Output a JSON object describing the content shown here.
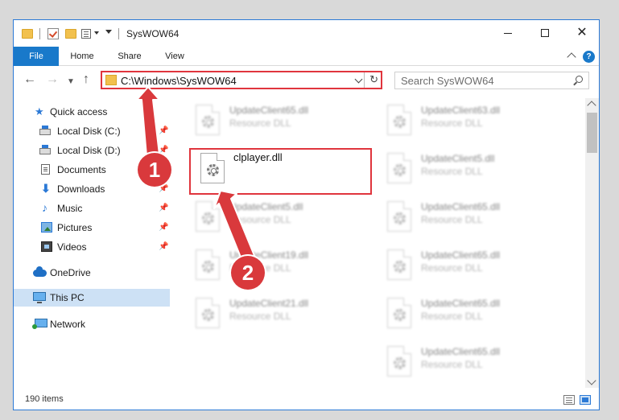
{
  "window": {
    "title": "SysWOW64",
    "accent_color": "#1979ca",
    "highlight_color": "#e0353d"
  },
  "ribbon": {
    "tabs": [
      "File",
      "Home",
      "Share",
      "View"
    ],
    "help_label": "?"
  },
  "address_bar": {
    "path": "C:\\Windows\\SysWOW64",
    "refresh_icon": "refresh-icon"
  },
  "search": {
    "placeholder": "Search SysWOW64"
  },
  "navigation": {
    "quick_access": {
      "label": "Quick access",
      "items": [
        {
          "label": "Local Disk (C:)",
          "icon": "drive-icon",
          "pinned": true
        },
        {
          "label": "Local Disk (D:)",
          "icon": "drive-icon",
          "pinned": true
        },
        {
          "label": "Documents",
          "icon": "documents-icon",
          "pinned": true
        },
        {
          "label": "Downloads",
          "icon": "downloads-icon",
          "pinned": true
        },
        {
          "label": "Music",
          "icon": "music-icon",
          "pinned": true
        },
        {
          "label": "Pictures",
          "icon": "pictures-icon",
          "pinned": true
        },
        {
          "label": "Videos",
          "icon": "videos-icon",
          "pinned": true
        }
      ]
    },
    "onedrive": "OneDrive",
    "this_pc": "This PC",
    "network": "Network",
    "pin_glyph": "📌"
  },
  "files": {
    "highlighted": {
      "name": "clplayer.dll"
    },
    "col1": [
      {
        "name": "UpdateClient65.dll",
        "type": "Resource DLL"
      },
      {
        "name": "UpdateClient5.dll",
        "type": "Resource DLL"
      },
      {
        "name": "UpdateClient19.dll",
        "type": "Resource DLL"
      },
      {
        "name": "UpdateClient21.dll",
        "type": "Resource DLL"
      }
    ],
    "col2": [
      {
        "name": "UpdateClient63.dll",
        "type": "Resource DLL"
      },
      {
        "name": "UpdateClient5.dll",
        "type": "Resource DLL"
      },
      {
        "name": "UpdateClient65.dll",
        "type": "Resource DLL"
      },
      {
        "name": "UpdateClient65.dll",
        "type": "Resource DLL"
      },
      {
        "name": "UpdateClient65.dll",
        "type": "Resource DLL"
      },
      {
        "name": "UpdateClient65.dll",
        "type": "Resource DLL"
      }
    ]
  },
  "status_bar": {
    "item_count": "190 items"
  },
  "annotations": {
    "step1": "1",
    "step2": "2"
  }
}
